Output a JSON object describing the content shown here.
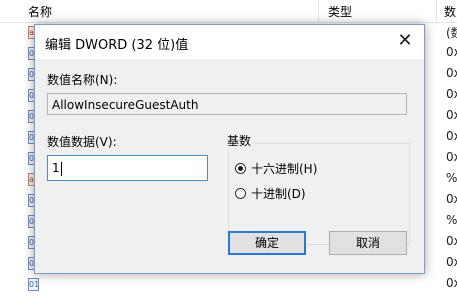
{
  "background": {
    "header": {
      "col_name": "名称",
      "col_type": "类型",
      "col_data": "数"
    },
    "rows": [
      {
        "icon": "ab",
        "value": "(数"
      },
      {
        "icon": "reg",
        "value": "0x"
      },
      {
        "icon": "reg",
        "value": "0x"
      },
      {
        "icon": "reg",
        "value": "0x"
      },
      {
        "icon": "reg",
        "value": "0x"
      },
      {
        "icon": "reg",
        "value": "0x"
      },
      {
        "icon": "reg",
        "value": "0x"
      },
      {
        "icon": "ab",
        "value": "%"
      },
      {
        "icon": "reg",
        "value": "0x"
      },
      {
        "icon": "reg",
        "value": "%"
      },
      {
        "icon": "reg",
        "value": "0x"
      },
      {
        "icon": "reg",
        "value": "0x"
      },
      {
        "icon": "reg",
        "value": "0x"
      }
    ]
  },
  "dialog": {
    "title": "编辑 DWORD (32 位)值",
    "close_symbol": "✕",
    "name_label": "数值名称(N):",
    "name_value": "AllowInsecureGuestAuth",
    "data_label": "数值数据(V):",
    "data_value": "1",
    "base_label": "基数",
    "base_options": [
      {
        "label": "十六进制(H)",
        "selected": true
      },
      {
        "label": "十进制(D)",
        "selected": false
      }
    ],
    "ok_label": "确定",
    "cancel_label": "取消"
  },
  "colors": {
    "accent": "#2a78d4",
    "dialog_border": "#7a9acb",
    "body_bg": "#f0f0f0"
  }
}
